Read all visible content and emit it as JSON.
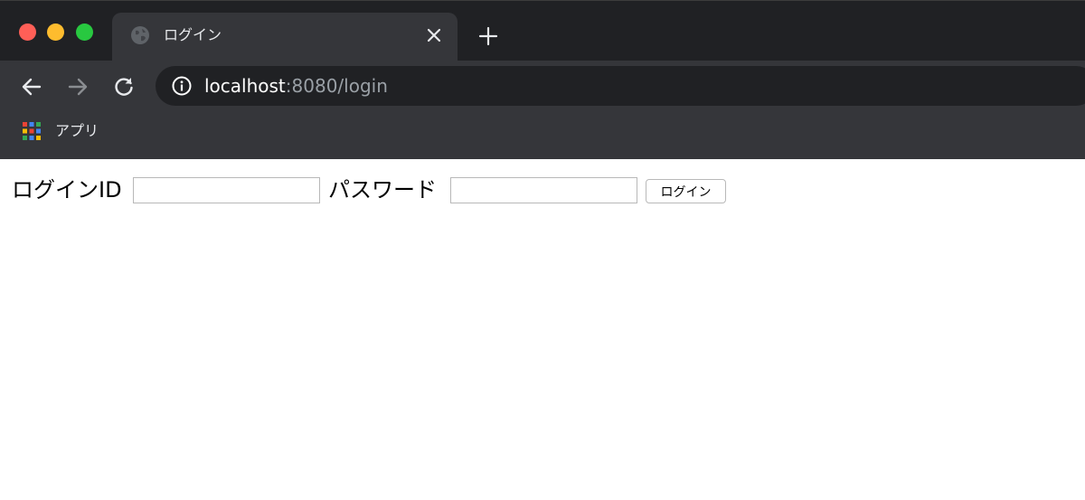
{
  "window": {
    "traffic_lights": {
      "close_color": "#ff5f57",
      "minimize_color": "#febc2e",
      "zoom_color": "#28c840"
    }
  },
  "tab": {
    "title": "ログイン",
    "favicon": "globe-icon"
  },
  "toolbar": {
    "url_host": "localhost",
    "url_rest": ":8080/login"
  },
  "bookmarks": {
    "apps_label": "アプリ"
  },
  "form": {
    "login_id_label": "ログインID",
    "login_id_value": "",
    "password_label": "パスワード",
    "password_value": "",
    "submit_label": "ログイン"
  },
  "colors": {
    "frame_dark": "#202124",
    "frame": "#35363a",
    "text_light": "#e8eaed",
    "url_muted": "#9aa0a6"
  }
}
